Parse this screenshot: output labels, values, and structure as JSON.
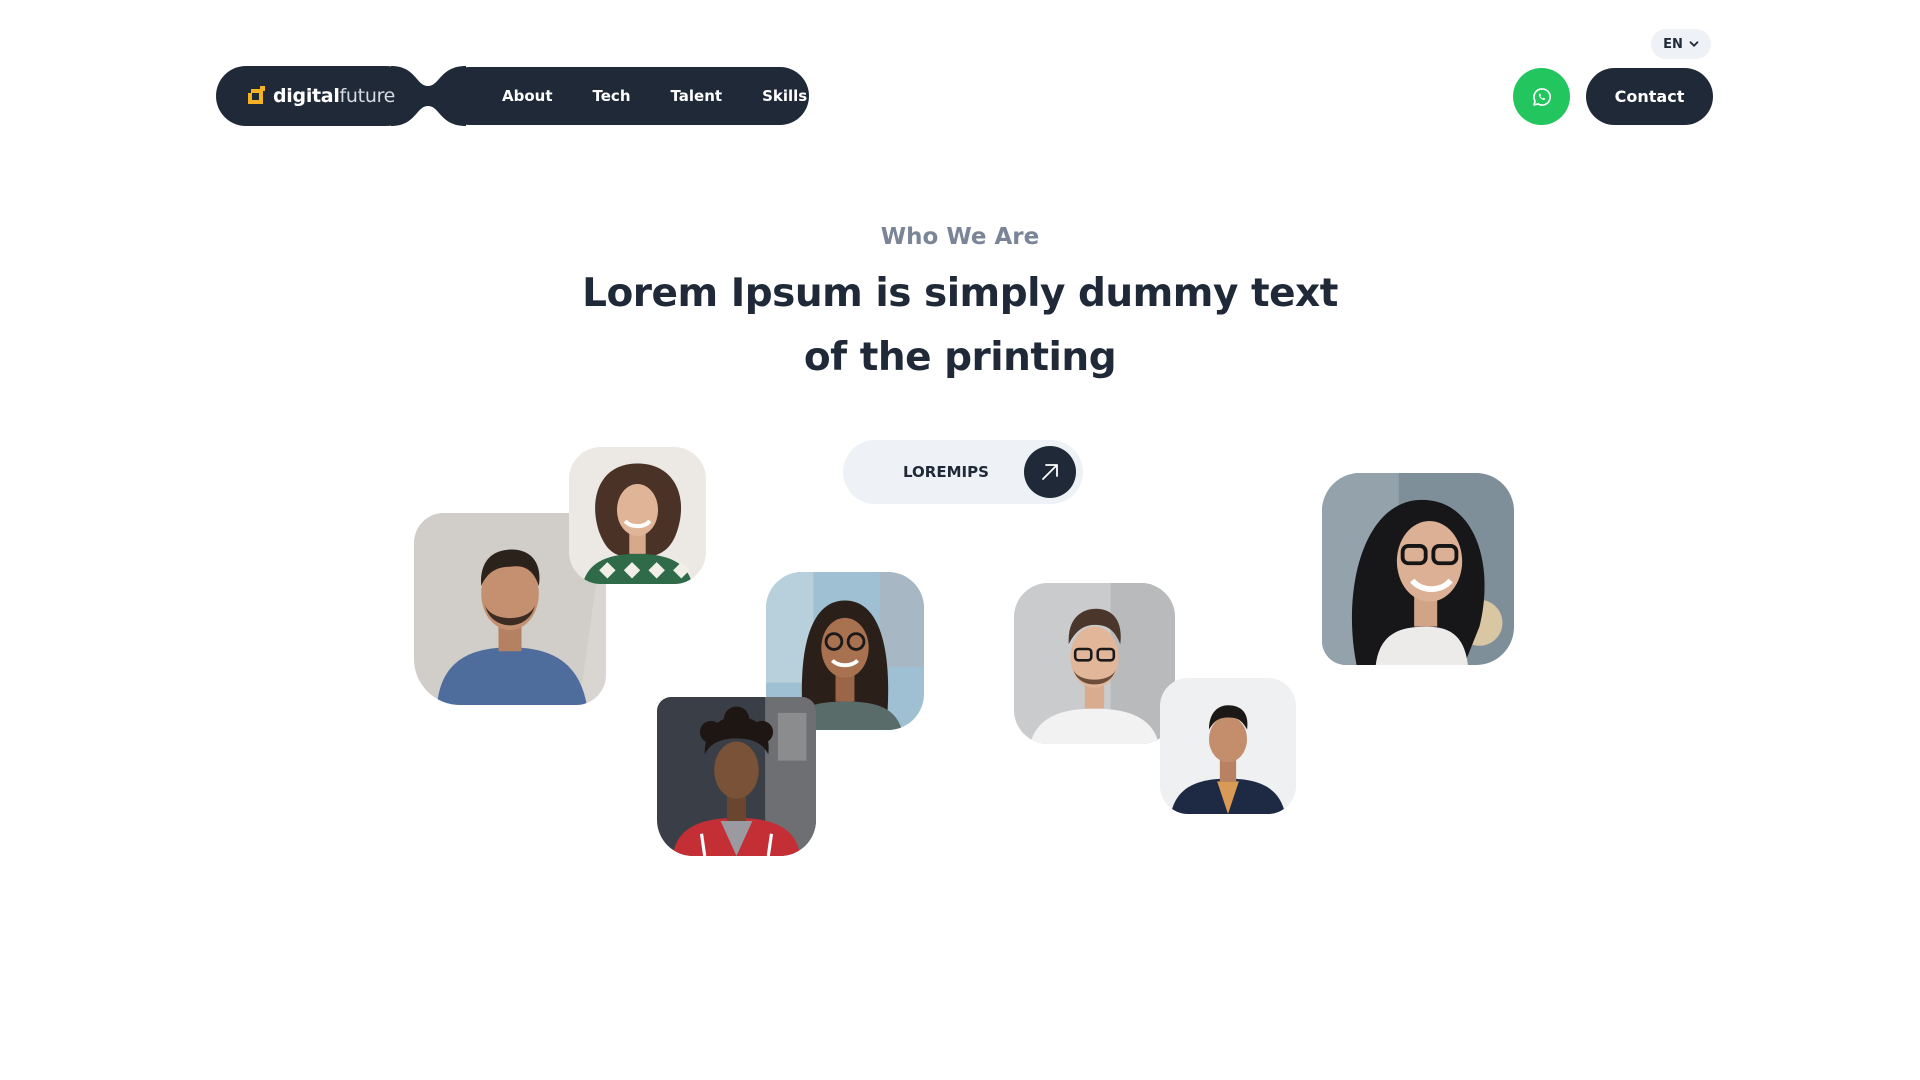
{
  "header": {
    "language": "EN",
    "logo": {
      "bold": "digital",
      "light": "future"
    },
    "nav": [
      {
        "label": "About"
      },
      {
        "label": "Tech"
      },
      {
        "label": "Talent"
      },
      {
        "label": "Skills"
      }
    ],
    "contact_label": "Contact",
    "icons": {
      "language_caret": "chevron-down-icon",
      "chat": "whatsapp-icon",
      "cta": "arrow-up-right-icon"
    }
  },
  "hero": {
    "eyebrow": "Who We Are",
    "headline": "Lorem Ipsum is simply dummy text of the printing",
    "cta_label": "LOREMIPS"
  },
  "colors": {
    "dark": "#1f2937",
    "whatsapp": "#22c55e",
    "muted": "#7a8598",
    "pill": "#eef1f5",
    "logo_accent": "#f5b324"
  }
}
